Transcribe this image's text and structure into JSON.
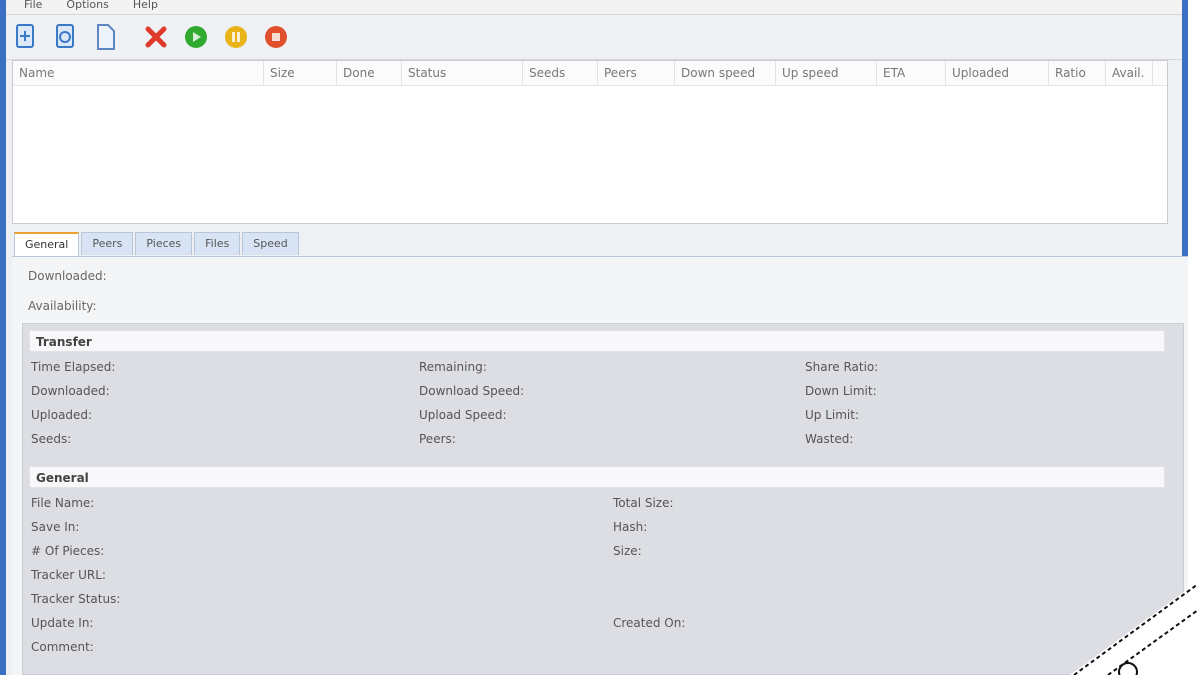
{
  "menu": [
    "File",
    "Options",
    "Help"
  ],
  "toolbar": {
    "icons": [
      {
        "name": "add-torrent-icon",
        "color": "#3a78c8"
      },
      {
        "name": "add-url-icon",
        "color": "#3a78c8"
      },
      {
        "name": "new-file-icon",
        "color": "#5d86c2"
      },
      {
        "name": "remove-icon",
        "color": "#e03a2c"
      },
      {
        "name": "start-icon",
        "color": "#2faa2f"
      },
      {
        "name": "pause-icon",
        "color": "#e8b41a"
      },
      {
        "name": "stop-icon",
        "color": "#e0502c"
      }
    ]
  },
  "columns": [
    "Name",
    "Size",
    "Done",
    "Status",
    "Seeds",
    "Peers",
    "Down speed",
    "Up speed",
    "ETA",
    "Uploaded",
    "Ratio",
    "Avail."
  ],
  "tabs": [
    "General",
    "Peers",
    "Pieces",
    "Files",
    "Speed"
  ],
  "info": {
    "downloaded": "Downloaded:",
    "availability": "Availability:"
  },
  "transfer": {
    "title": "Transfer",
    "col1": [
      "Time Elapsed:",
      "Downloaded:",
      "Uploaded:",
      "Seeds:"
    ],
    "col2": [
      "Remaining:",
      "Download Speed:",
      "Upload Speed:",
      "Peers:"
    ],
    "col3": [
      "Share Ratio:",
      "Down Limit:",
      "Up Limit:",
      "Wasted:"
    ]
  },
  "general": {
    "title": "General",
    "col1": [
      "File Name:",
      "Save In:",
      "# Of Pieces:",
      "Tracker URL:",
      "Tracker Status:",
      "Update In:",
      "Comment:"
    ],
    "col2": [
      "Total Size:",
      "Hash:",
      "Size:",
      "",
      "",
      "Created On:",
      ""
    ]
  }
}
